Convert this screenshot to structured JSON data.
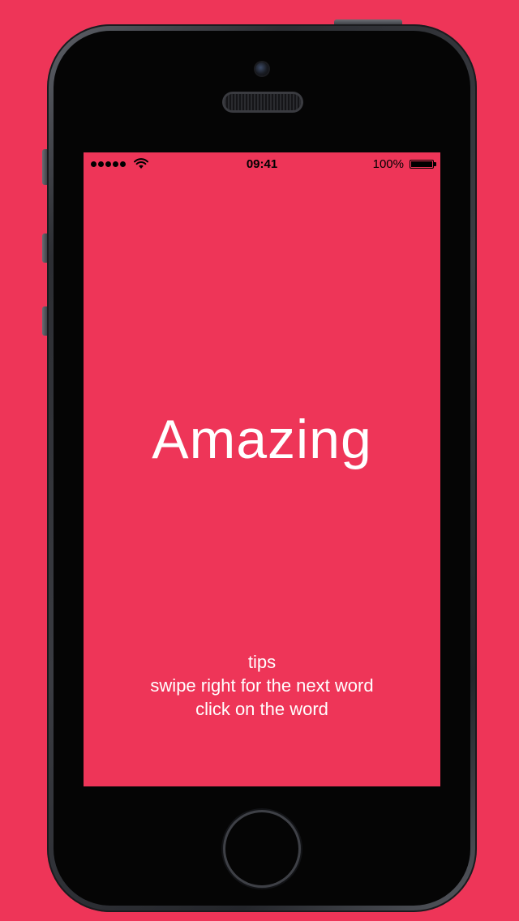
{
  "status_bar": {
    "time": "09:41",
    "battery_percent": "100%",
    "signal_bars": 5,
    "battery_level": 1.0
  },
  "word": {
    "text": "Amazing"
  },
  "tips": {
    "title": "tips",
    "line1": "swipe right for the next word",
    "line2": "click on the word"
  },
  "colors": {
    "background": "#ee3558",
    "text": "#ffffff"
  },
  "icons": {
    "signal": "signal-dots-icon",
    "wifi": "wifi-icon",
    "battery": "battery-icon"
  }
}
